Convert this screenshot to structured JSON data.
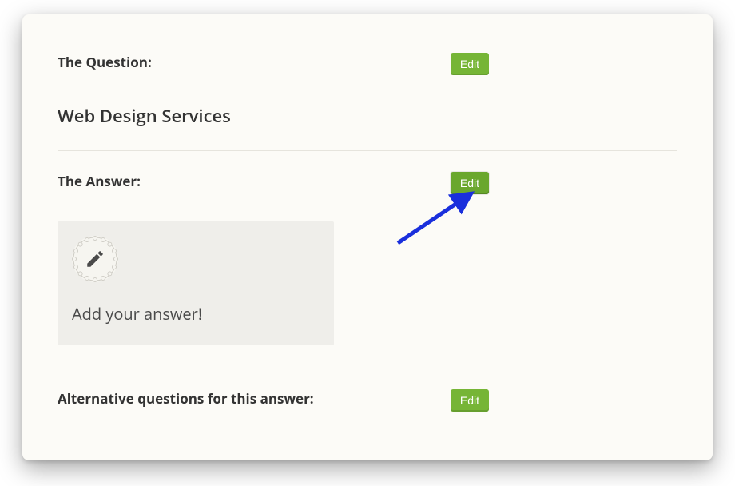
{
  "question": {
    "label": "The Question:",
    "edit_label": "Edit",
    "text": "Web Design Services"
  },
  "answer": {
    "label": "The Answer:",
    "edit_label": "Edit",
    "placeholder_text": "Add your answer!"
  },
  "alternatives": {
    "label": "Alternative questions for this answer:",
    "edit_label": "Edit"
  },
  "colors": {
    "button_green": "#76b536",
    "card_bg": "#fcfbf7",
    "arrow_blue": "#1a2fdc"
  }
}
